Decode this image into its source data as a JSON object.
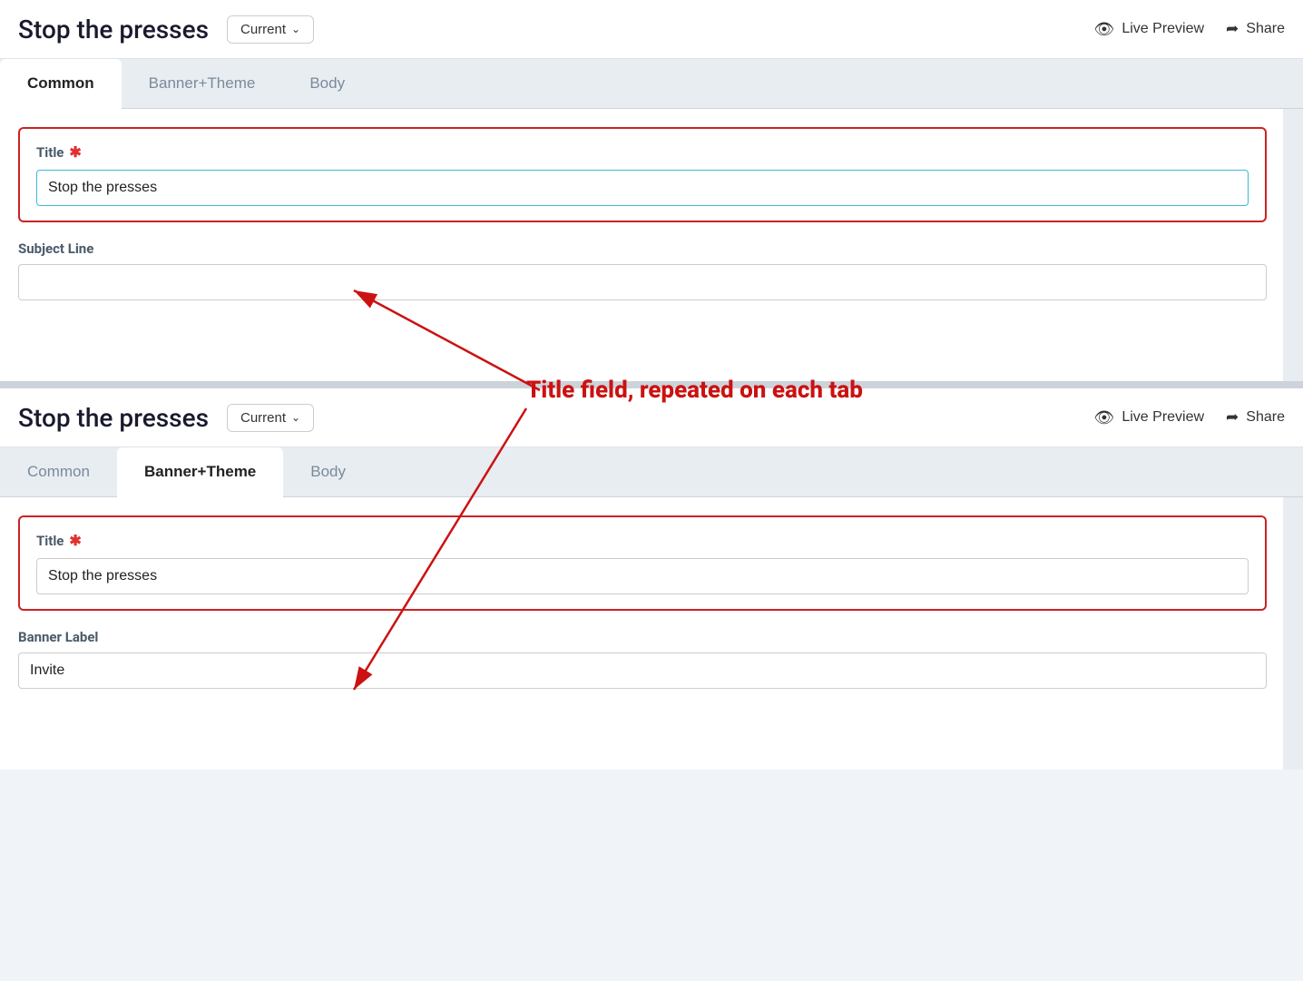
{
  "page": {
    "title": "Stop the presses",
    "dropdown_label": "Current",
    "dropdown_icon": "chevron-down",
    "live_preview_label": "Live Preview",
    "share_label": "Share"
  },
  "panel1": {
    "tabs": [
      {
        "id": "common",
        "label": "Common",
        "active": true
      },
      {
        "id": "banner_theme",
        "label": "Banner+Theme",
        "active": false
      },
      {
        "id": "body",
        "label": "Body",
        "active": false
      }
    ],
    "title_field": {
      "label": "Title",
      "required": true,
      "value": "Stop the presses",
      "focused": true
    },
    "subject_line_field": {
      "label": "Subject Line",
      "required": false,
      "value": "",
      "placeholder": ""
    }
  },
  "panel2": {
    "tabs": [
      {
        "id": "common",
        "label": "Common",
        "active": false
      },
      {
        "id": "banner_theme",
        "label": "Banner+Theme",
        "active": true
      },
      {
        "id": "body",
        "label": "Body",
        "active": false
      }
    ],
    "title_field": {
      "label": "Title",
      "required": true,
      "value": "Stop the presses"
    },
    "banner_label_field": {
      "label": "Banner Label",
      "required": false,
      "value": "Invite"
    }
  },
  "annotation": {
    "text": "Title field, repeated on each tab"
  },
  "icons": {
    "eye": "👁",
    "share": "➦",
    "chevron_down": "∨"
  }
}
